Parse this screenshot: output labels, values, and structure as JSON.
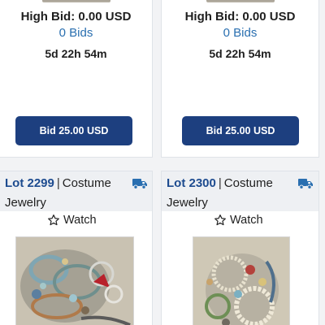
{
  "cards_top": [
    {
      "high_bid": "High Bid: 0.00 USD",
      "bids": "0 Bids",
      "time_left": "5d 22h 54m",
      "bid_button": "Bid 25.00 USD"
    },
    {
      "high_bid": "High Bid: 0.00 USD",
      "bids": "0 Bids",
      "time_left": "5d 22h 54m",
      "bid_button": "Bid 25.00 USD"
    }
  ],
  "cards_bottom": [
    {
      "lot_label": "Lot 2299",
      "category_part1": "Costume",
      "category_part2": "Jewelry",
      "watch_label": "Watch",
      "shipping_icon": "truck-icon",
      "watch_icon": "star-outline-icon"
    },
    {
      "lot_label": "Lot 2300",
      "category_part1": "Costume",
      "category_part2": "Jewelry",
      "watch_label": "Watch",
      "shipping_icon": "truck-icon",
      "watch_icon": "star-outline-icon"
    }
  ],
  "colors": {
    "link_blue": "#2a6fb0",
    "lot_blue": "#1d4b8f",
    "button_navy": "#1d3f7f",
    "header_bg": "#eef0f3"
  }
}
